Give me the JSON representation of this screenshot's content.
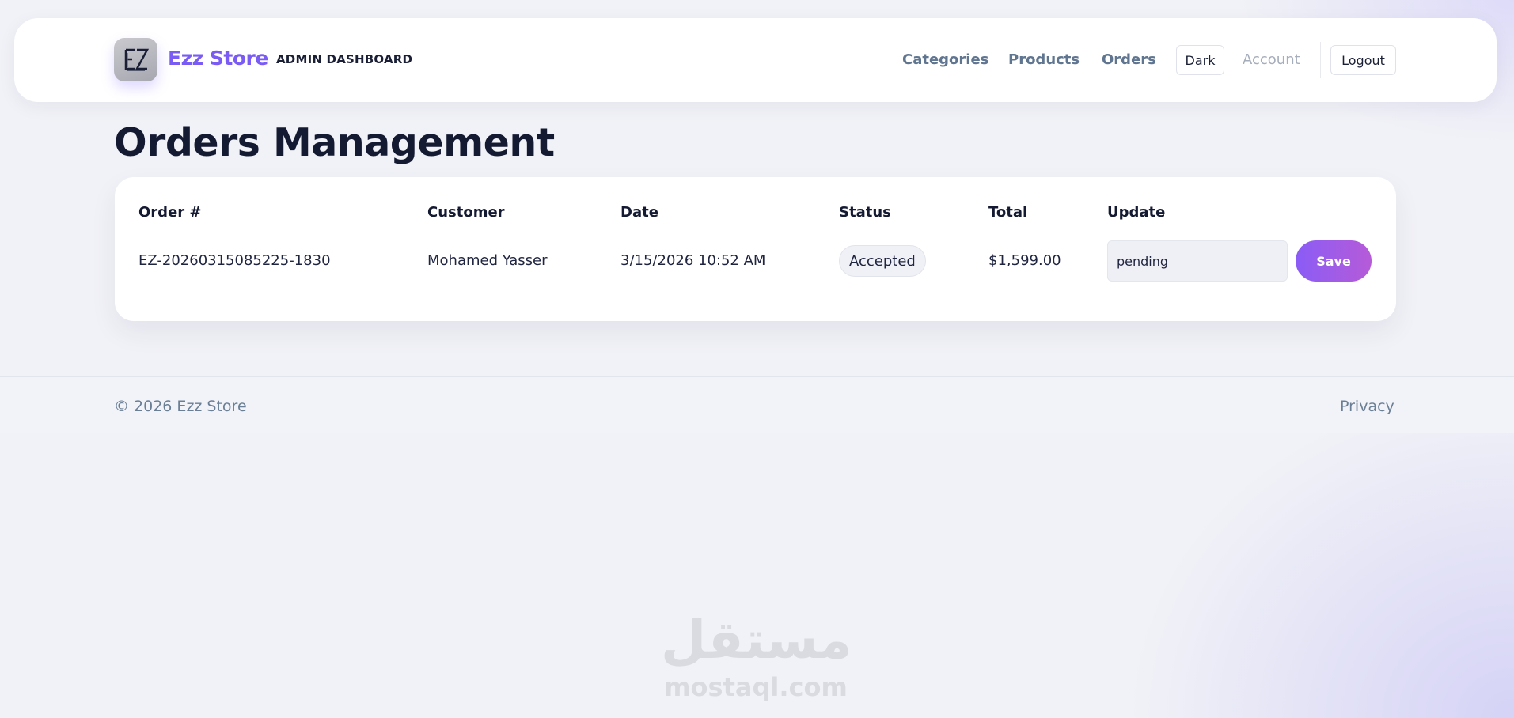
{
  "header": {
    "brand_name": "Ezz Store",
    "admin_badge": "ADMIN DASHBOARD",
    "logo_text": "EZ",
    "nav": {
      "categories": "Categories",
      "products": "Products",
      "orders": "Orders",
      "theme_toggle": "Dark",
      "account": "Account",
      "logout": "Logout"
    }
  },
  "page": {
    "title": "Orders Management"
  },
  "orders_table": {
    "columns": [
      "Order #",
      "Customer",
      "Date",
      "Status",
      "Total",
      "Update"
    ],
    "rows": [
      {
        "order_number": "EZ-20260315085225-1830",
        "customer": "Mohamed Yasser",
        "date": "3/15/2026 10:52 AM",
        "status": "Accepted",
        "total": "$1,599.00",
        "update_value": "pending",
        "save_label": "Save"
      }
    ]
  },
  "footer": {
    "copyright": "© 2026 Ezz Store",
    "privacy": "Privacy"
  },
  "watermark": {
    "arabic": "مستقل",
    "latin": "mostaql.com"
  },
  "colors": {
    "brand": "#7a5cf4",
    "nav_text": "#5f7590",
    "save_gradient_start": "#8a5cf6",
    "save_gradient_end": "#b65bd8",
    "background": "#f1f2f7"
  }
}
